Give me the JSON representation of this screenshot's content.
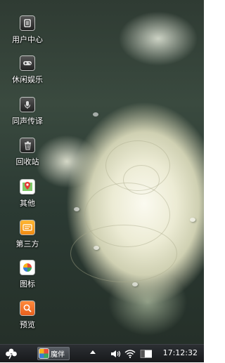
{
  "desktop": {
    "icons": [
      {
        "label": "用户中心",
        "icon": "user-center-icon"
      },
      {
        "label": "休闲娱乐",
        "icon": "gamepad-icon"
      },
      {
        "label": "同声传译",
        "icon": "microphone-icon"
      },
      {
        "label": "回收站",
        "icon": "recycle-bin-icon"
      },
      {
        "label": "其他",
        "icon": "map-pin-icon"
      },
      {
        "label": "第三方",
        "icon": "third-party-icon"
      },
      {
        "label": "图标",
        "icon": "colorful-grid-icon"
      },
      {
        "label": "预览",
        "icon": "preview-icon"
      }
    ]
  },
  "taskbar": {
    "start_icon": "clover-icon",
    "task_label": "魔伴",
    "tray": {
      "icons": [
        "show-hidden-icon",
        "volume-icon",
        "wifi-icon",
        "battery-icon"
      ],
      "time": "17:12:32"
    }
  },
  "colors": {
    "taskbar": "#1e2124",
    "label_text": "#ffffff",
    "accent_orange": "#f39a1e"
  }
}
